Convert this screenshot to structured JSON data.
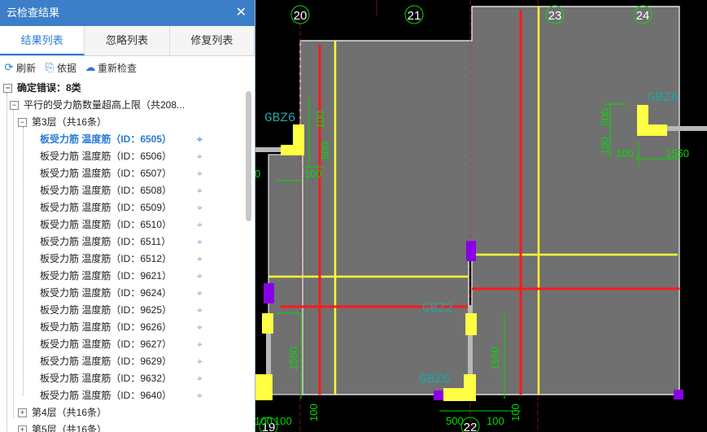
{
  "panel": {
    "title": "云检查结果",
    "close": "✕",
    "tabs": [
      "结果列表",
      "忽略列表",
      "修复列表"
    ],
    "toolbar": {
      "refresh": "刷新",
      "basis": "依据",
      "recheck": "重新检查"
    },
    "tree": {
      "root": "确定错误：8类",
      "category": "平行的受力筋数量超高上限（共208...",
      "floor3": "第3层（共16条）",
      "items": [
        "板受力筋 温度筋（ID：6505）",
        "板受力筋 温度筋（ID：6506）",
        "板受力筋 温度筋（ID：6507）",
        "板受力筋 温度筋（ID：6508）",
        "板受力筋 温度筋（ID：6509）",
        "板受力筋 温度筋（ID：6510）",
        "板受力筋 温度筋（ID：6511）",
        "板受力筋 温度筋（ID：6512）",
        "板受力筋 温度筋（ID：9621）",
        "板受力筋 温度筋（ID：9624）",
        "板受力筋 温度筋（ID：9625）",
        "板受力筋 温度筋（ID：9626）",
        "板受力筋 温度筋（ID：9627）",
        "板受力筋 温度筋（ID：9629）",
        "板受力筋 温度筋（ID：9632）",
        "板受力筋 温度筋（ID：9640）"
      ],
      "floor4": "第4层（共16条）",
      "floor5": "第5层（共16条）"
    }
  },
  "cad": {
    "axes": [
      "20",
      "21",
      "23",
      "24",
      "19",
      "22"
    ],
    "labels": [
      "GBZ6",
      "GBZ6",
      "GBZ6",
      "GBZ2"
    ],
    "dims": [
      "100",
      "500",
      "100",
      "100",
      "500",
      "100",
      "1550",
      "1550",
      "1550",
      "100",
      "100",
      "500",
      "100",
      "100",
      "0",
      "100"
    ]
  },
  "colors": {
    "titlebar": "#3c7fc8",
    "accent": "#2a7bd6",
    "slab": "#707070",
    "rebar_red": "#ff1a1a",
    "rebar_yellow": "#ffff33",
    "dim_green": "#00dd00"
  }
}
